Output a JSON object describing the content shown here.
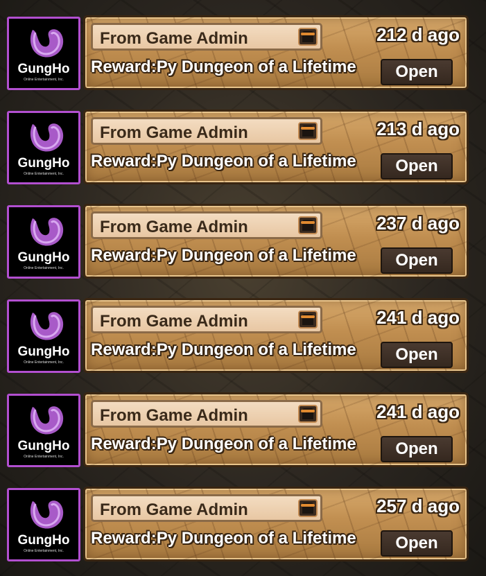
{
  "logo": {
    "name": "GungHo",
    "tagline": "Online Entertainment, Inc."
  },
  "mails": [
    {
      "sender": "From Game Admin",
      "time": "212 d ago",
      "subject": "Reward:Py Dungeon of a Lifetime",
      "button": "Open"
    },
    {
      "sender": "From Game Admin",
      "time": "213 d ago",
      "subject": "Reward:Py Dungeon of a Lifetime",
      "button": "Open"
    },
    {
      "sender": "From Game Admin",
      "time": "237 d ago",
      "subject": "Reward:Py Dungeon of a Lifetime",
      "button": "Open"
    },
    {
      "sender": "From Game Admin",
      "time": "241 d ago",
      "subject": "Reward:Py Dungeon of a Lifetime",
      "button": "Open"
    },
    {
      "sender": "From Game Admin",
      "time": "241 d ago",
      "subject": "Reward:Py Dungeon of a Lifetime",
      "button": "Open"
    },
    {
      "sender": "From Game Admin",
      "time": "257 d ago",
      "subject": "Reward:Py Dungeon of a Lifetime",
      "button": "Open"
    }
  ],
  "icons": {
    "logo": "gungho-logo-icon",
    "chest": "treasure-chest-icon"
  },
  "colors": {
    "panel": "#c08e50",
    "logo_border": "#b24fd0",
    "button": "#35281f"
  }
}
